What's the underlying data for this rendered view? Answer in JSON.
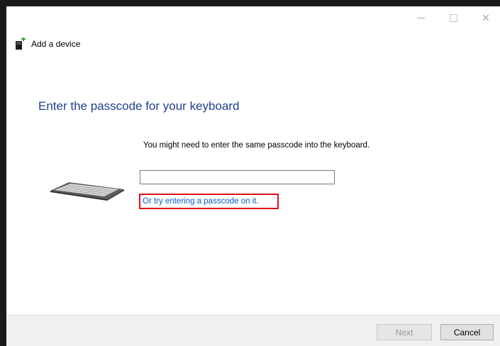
{
  "window": {
    "caption": {
      "minimize_icon": "minimize-icon",
      "maximize_icon": "maximize-icon",
      "close_glyph": "✕"
    }
  },
  "header": {
    "icon": "device-icon",
    "title": "Add a device"
  },
  "main": {
    "heading": "Enter the passcode for your keyboard",
    "instructions": "You might need to enter the same passcode into the keyboard.",
    "image": "keyboard-icon",
    "passcode_input": {
      "value": "",
      "placeholder": ""
    },
    "alt_link": "Or try entering a passcode on it."
  },
  "footer": {
    "next_label": "Next",
    "cancel_label": "Cancel"
  },
  "colors": {
    "heading": "#1e3f8f",
    "link": "#0b5cc5",
    "highlight_box": "#e0101a",
    "device_icon_accent": "#2fa83f"
  }
}
